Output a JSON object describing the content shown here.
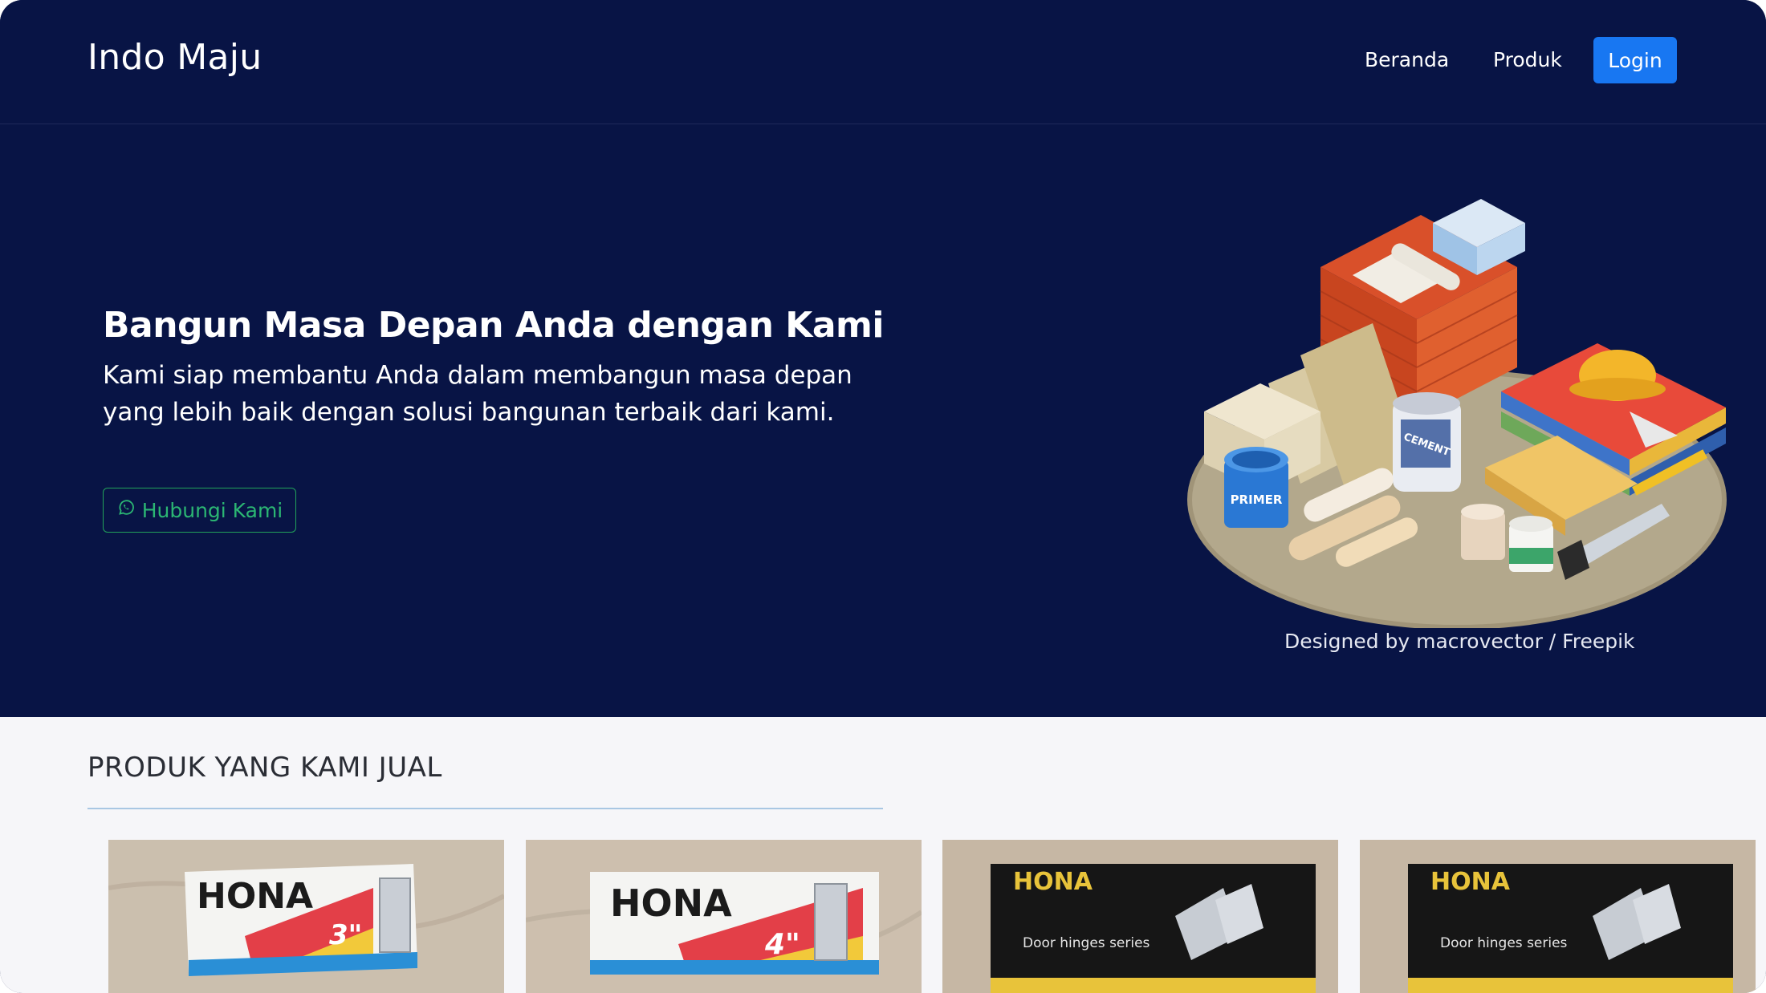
{
  "brand": {
    "name": "Indo Maju"
  },
  "nav": {
    "home": "Beranda",
    "products": "Produk",
    "login": "Login"
  },
  "hero": {
    "title": "Bangun Masa Depan Anda dengan Kami",
    "text": "Kami siap membantu Anda dalam membangun masa depan yang lebih baik dengan solusi bangunan terbaik dari kami.",
    "button_label": "Hubungi Kami",
    "button_icon": "whatsapp-icon",
    "credit": "Designed by macrovector / Freepik",
    "illustration_labels": {
      "primer": "PRIMER",
      "cement": "CEMENT"
    }
  },
  "products": {
    "section_title": "PRODUK YANG KAMI JUAL",
    "items": [
      {
        "brand": "HONA",
        "size": "3\"",
        "series": ""
      },
      {
        "brand": "HONA",
        "size": "4\"",
        "series": ""
      },
      {
        "brand": "HONA",
        "size": "",
        "series": "Door hinges series"
      },
      {
        "brand": "HONA",
        "size": "",
        "series": "Door hinges series"
      }
    ]
  },
  "colors": {
    "navy": "#081445",
    "login_blue": "#1877f2",
    "whatsapp_green": "#22a35a",
    "section_bg": "#f6f6f9"
  }
}
